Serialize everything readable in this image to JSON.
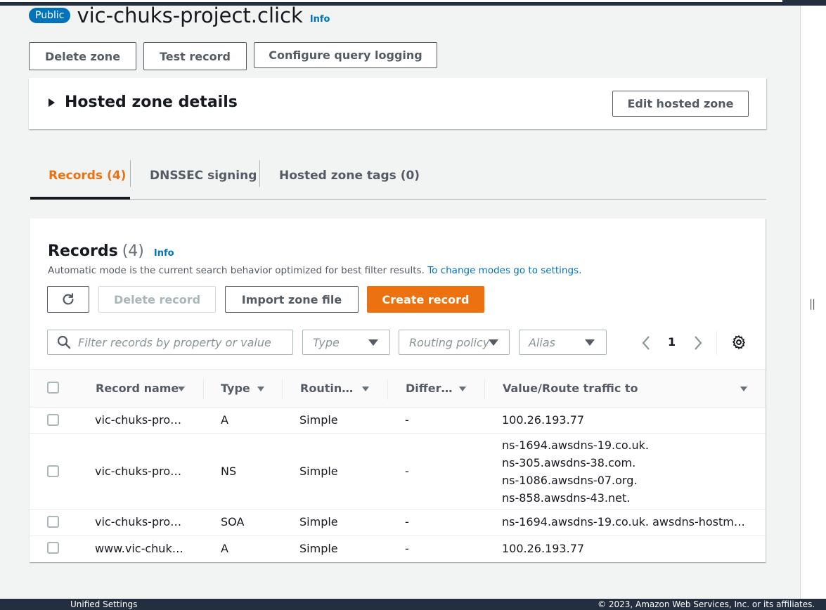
{
  "header": {
    "badge": "Public",
    "title": "vic-chuks-project.click",
    "info": "Info"
  },
  "actions": {
    "delete_zone": "Delete zone",
    "test_record": "Test record",
    "configure_query_logging": "Configure query logging"
  },
  "hosted_zone_details": {
    "title": "Hosted zone details",
    "edit_button": "Edit hosted zone"
  },
  "tabs": [
    {
      "label": "Records (4)",
      "active": true
    },
    {
      "label": "DNSSEC signing",
      "active": false
    },
    {
      "label": "Hosted zone tags (0)",
      "active": false
    }
  ],
  "records_panel": {
    "title": "Records",
    "count": "(4)",
    "info": "Info",
    "description": "Automatic mode is the current search behavior optimized for best filter results.",
    "description_link": "To change modes go to settings.",
    "refresh_icon": "refresh-icon",
    "delete_record": "Delete record",
    "import_zone_file": "Import zone file",
    "create_record": "Create record",
    "search_placeholder": "Filter records by property or value",
    "type_filter": "Type",
    "routing_filter": "Routing policy",
    "alias_filter": "Alias",
    "page": "1"
  },
  "table": {
    "columns": [
      "Record name",
      "Type",
      "Routin…",
      "Differ…",
      "Value/Route traffic to"
    ],
    "rows": [
      {
        "name": "vic-chuks-pro…",
        "type": "A",
        "routing": "Simple",
        "differ": "-",
        "value": [
          "100.26.193.77"
        ]
      },
      {
        "name": "vic-chuks-pro…",
        "type": "NS",
        "routing": "Simple",
        "differ": "-",
        "value": [
          "ns-1694.awsdns-19.co.uk.",
          "ns-305.awsdns-38.com.",
          "ns-1086.awsdns-07.org.",
          "ns-858.awsdns-43.net."
        ]
      },
      {
        "name": "vic-chuks-pro…",
        "type": "SOA",
        "routing": "Simple",
        "differ": "-",
        "value": [
          "ns-1694.awsdns-19.co.uk. awsdns-hostm…"
        ]
      },
      {
        "name": "www.vic-chuk…",
        "type": "A",
        "routing": "Simple",
        "differ": "-",
        "value": [
          "100.26.193.77"
        ]
      }
    ]
  },
  "footer": {
    "left": "Unified Settings",
    "right": "© 2023, Amazon Web Services, Inc. or its affiliates."
  },
  "colors": {
    "accent_orange": "#ec7211",
    "link_blue": "#0073bb",
    "nav_dark": "#232f3e"
  }
}
